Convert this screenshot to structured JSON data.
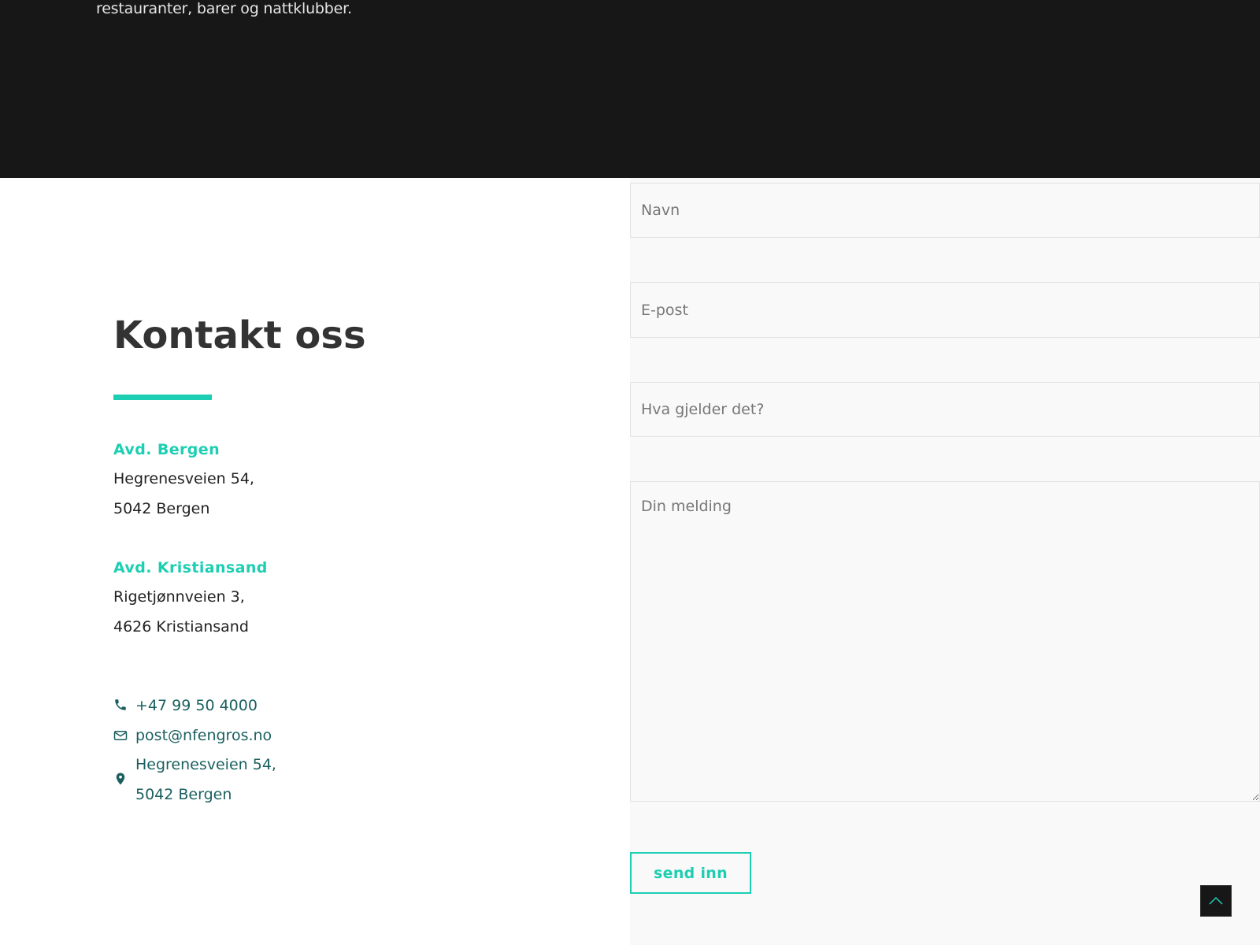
{
  "hero": {
    "tagline": "restauranter, barer og nattklubber."
  },
  "contact": {
    "title": "Kontakt oss",
    "accent_color": "#1ccfb2",
    "offices": [
      {
        "name": "Avd. Bergen",
        "street": "Hegrenesveien 54,",
        "city": "5042 Bergen"
      },
      {
        "name": "Avd. Kristiansand",
        "street": "Rigetjønnveien 3,",
        "city": "4626 Kristiansand"
      }
    ],
    "phone": {
      "icon": "phone-icon",
      "text": "+47 99 50 4000"
    },
    "email": {
      "icon": "envelope-icon",
      "text": "post@nfengros.no"
    },
    "address": {
      "icon": "map-pin-icon",
      "line1": "Hegrenesveien 54,",
      "line2": "5042 Bergen"
    }
  },
  "form": {
    "name_placeholder": "Navn",
    "email_placeholder": "E-post",
    "subject_placeholder": "Hva gjelder det?",
    "message_placeholder": "Din melding",
    "submit_label": "send inn"
  },
  "scroll_top": {
    "icon": "chevron-up-icon"
  }
}
